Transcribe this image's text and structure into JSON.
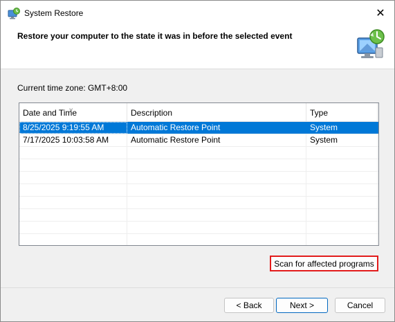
{
  "window": {
    "title": "System Restore",
    "close_glyph": "✕",
    "title_icon": "system-restore-icon",
    "header_icon": "restore-computer-icon"
  },
  "header": {
    "title": "Restore your computer to the state it was in before the selected event"
  },
  "timezone_label": "Current time zone: GMT+8:00",
  "table": {
    "columns": [
      "Date and Time",
      "Description",
      "Type"
    ],
    "sort_indicator": "˅",
    "rows": [
      {
        "date": "8/25/2025 9:19:55 AM",
        "description": "Automatic Restore Point",
        "type": "System",
        "selected": true
      },
      {
        "date": "7/17/2025 10:03:58 AM",
        "description": "Automatic Restore Point",
        "type": "System",
        "selected": false
      }
    ]
  },
  "buttons": {
    "scan": "Scan for affected programs",
    "back": "< Back",
    "next": "Next >",
    "cancel": "Cancel"
  },
  "colors": {
    "selection": "#0078d7",
    "highlight_border": "#e21b1b"
  }
}
